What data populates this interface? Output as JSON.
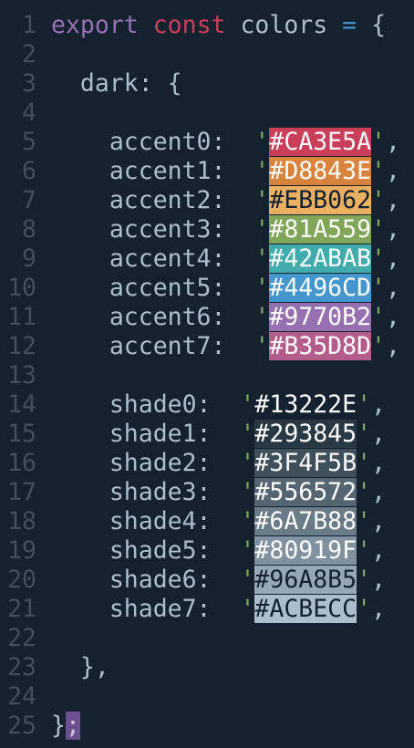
{
  "editor": {
    "line_numbers": [
      "1",
      "2",
      "3",
      "4",
      "5",
      "6",
      "7",
      "8",
      "9",
      "10",
      "11",
      "12",
      "13",
      "14",
      "15",
      "16",
      "17",
      "18",
      "19",
      "20",
      "21",
      "22",
      "23",
      "24",
      "25"
    ],
    "line1": {
      "export": "export",
      "const": "const",
      "name": "colors",
      "eq": "=",
      "brace": "{"
    },
    "line3": {
      "key": "dark:",
      "brace": "{"
    },
    "accents": [
      {
        "key": "accent0:",
        "value": "#CA3E5A",
        "color": "#CA3E5A"
      },
      {
        "key": "accent1:",
        "value": "#D8843E",
        "color": "#D8843E"
      },
      {
        "key": "accent2:",
        "value": "#EBB062",
        "color": "#EBB062"
      },
      {
        "key": "accent3:",
        "value": "#81A559",
        "color": "#81A559"
      },
      {
        "key": "accent4:",
        "value": "#42ABAB",
        "color": "#42ABAB"
      },
      {
        "key": "accent5:",
        "value": "#4496CD",
        "color": "#4496CD"
      },
      {
        "key": "accent6:",
        "value": "#9770B2",
        "color": "#9770B2"
      },
      {
        "key": "accent7:",
        "value": "#B35D8D",
        "color": "#B35D8D"
      }
    ],
    "shades": [
      {
        "key": "shade0:",
        "value": "#13222E",
        "color": "#13222E"
      },
      {
        "key": "shade1:",
        "value": "#293845",
        "color": "#293845"
      },
      {
        "key": "shade2:",
        "value": "#3F4F5B",
        "color": "#3F4F5B"
      },
      {
        "key": "shade3:",
        "value": "#556572",
        "color": "#556572"
      },
      {
        "key": "shade4:",
        "value": "#6A7B88",
        "color": "#6A7B88"
      },
      {
        "key": "shade5:",
        "value": "#80919F",
        "color": "#80919F"
      },
      {
        "key": "shade6:",
        "value": "#96A8B5",
        "color": "#96A8B5"
      },
      {
        "key": "shade7:",
        "value": "#ACBECC",
        "color": "#ACBECC"
      }
    ],
    "line23": "},",
    "line25": {
      "brace": "}",
      "semicolon": ";"
    },
    "quote": "'",
    "comma": ","
  }
}
